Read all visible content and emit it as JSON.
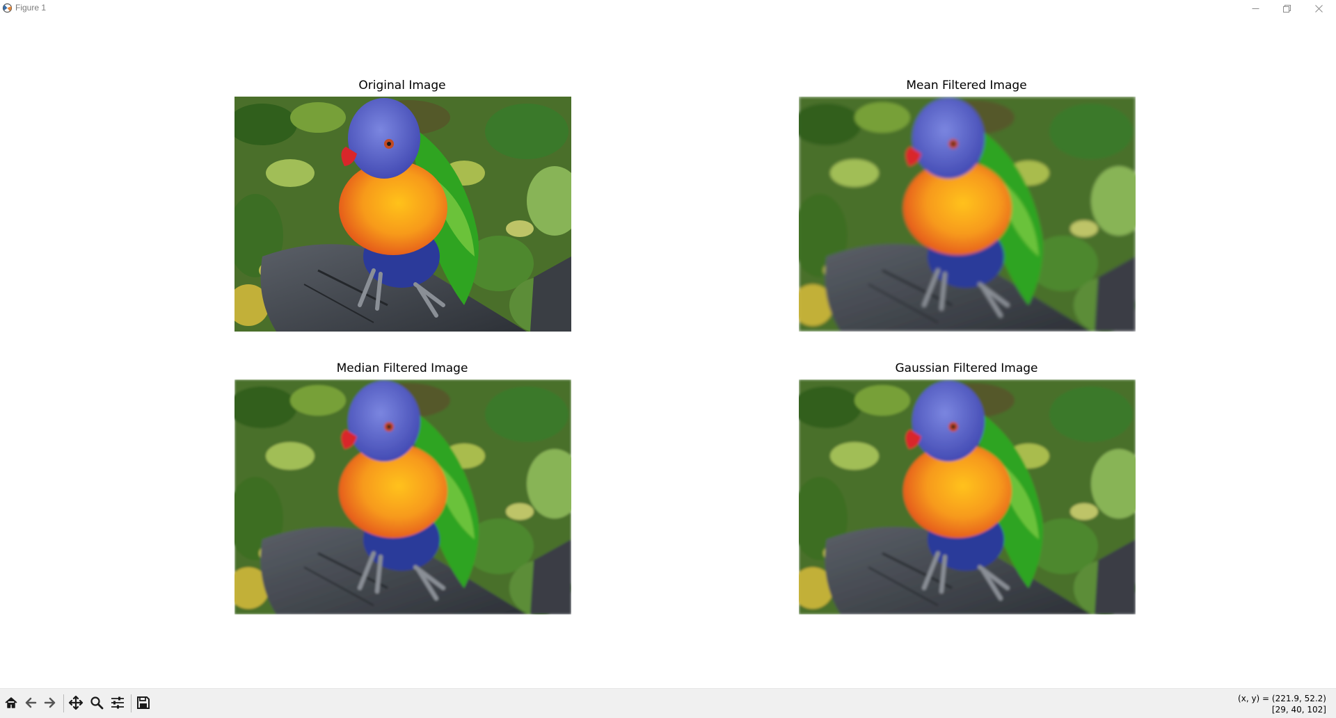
{
  "window": {
    "title": "Figure 1",
    "controls": [
      "minimize-icon",
      "restore-icon",
      "close-icon"
    ]
  },
  "figure": {
    "axes": [
      {
        "title": "Original Image",
        "image": "rainbow lorikeet parrot perched on dark wood, sharp"
      },
      {
        "title": "Mean Filtered Image",
        "image": "rainbow lorikeet parrot, blurred by mean filter"
      },
      {
        "title": "Median Filtered Image",
        "image": "rainbow lorikeet parrot, smoothed by median filter"
      },
      {
        "title": "Gaussian Filtered Image",
        "image": "rainbow lorikeet parrot, smoothed by gaussian filter"
      }
    ]
  },
  "toolbar": {
    "buttons": [
      "home-icon",
      "back-icon",
      "forward-icon",
      "pan-icon",
      "zoom-icon",
      "configure-subplots-icon",
      "save-icon"
    ],
    "status_line1": "(x, y) = (221.9, 52.2)",
    "status_line2": "[29, 40, 102]"
  },
  "colors": {
    "background": "#ffffff",
    "toolbar": "#f0f0f0",
    "parrot_head": "#5560c8",
    "parrot_chest": "#f79a1a",
    "parrot_wing": "#2fa421",
    "perch": "#3f444c",
    "foliage": "#3e7a22"
  }
}
